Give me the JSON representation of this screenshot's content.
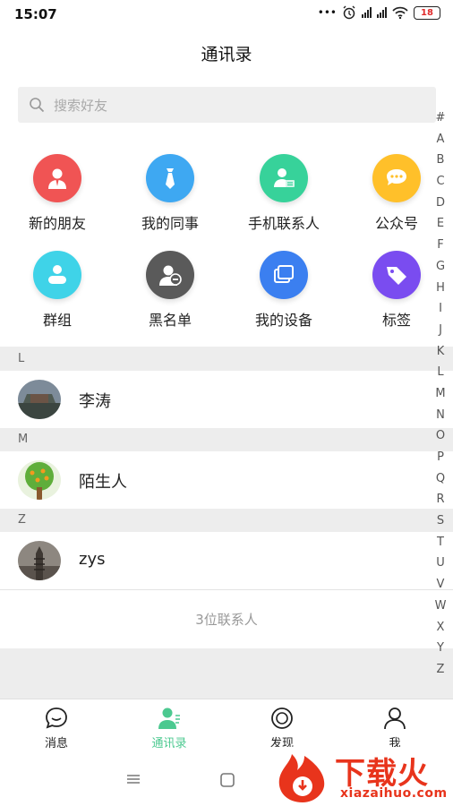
{
  "status_bar": {
    "time": "15:07",
    "battery": "18",
    "dots": "•••"
  },
  "header": {
    "title": "通讯录"
  },
  "search": {
    "placeholder": "搜索好友"
  },
  "quick_entries": [
    {
      "label": "新的朋友",
      "icon": "new-friend-icon",
      "color": "#f05454"
    },
    {
      "label": "我的同事",
      "icon": "tie-icon",
      "color": "#3ea8f2"
    },
    {
      "label": "手机联系人",
      "icon": "phone-contact-icon",
      "color": "#37d29a"
    },
    {
      "label": "公众号",
      "icon": "chat-bubble-icon",
      "color": "#ffc02a"
    },
    {
      "label": "群组",
      "icon": "group-icon",
      "color": "#3fd3e8"
    },
    {
      "label": "黑名单",
      "icon": "blocked-user-icon",
      "color": "#5a5a5a"
    },
    {
      "label": "我的设备",
      "icon": "device-icon",
      "color": "#3b7ff0"
    },
    {
      "label": "标签",
      "icon": "tag-icon",
      "color": "#7a4cf0"
    }
  ],
  "contacts": [
    {
      "section": "L",
      "name": "李涛"
    },
    {
      "section": "M",
      "name": "陌生人"
    },
    {
      "section": "Z",
      "name": "zys"
    }
  ],
  "contact_count": "3位联系人",
  "alphabet": [
    "#",
    "A",
    "B",
    "C",
    "D",
    "E",
    "F",
    "G",
    "H",
    "I",
    "J",
    "K",
    "L",
    "M",
    "N",
    "O",
    "P",
    "Q",
    "R",
    "S",
    "T",
    "U",
    "V",
    "W",
    "X",
    "Y",
    "Z"
  ],
  "tabs": [
    {
      "label": "消息",
      "icon": "message-icon",
      "active": false
    },
    {
      "label": "通讯录",
      "icon": "contacts-icon",
      "active": true
    },
    {
      "label": "发现",
      "icon": "discover-icon",
      "active": false
    },
    {
      "label": "我",
      "icon": "profile-icon",
      "active": false
    }
  ],
  "accent_color": "#4cc990",
  "watermark": {
    "text": "下载火",
    "sub": "xiazaihuo.com"
  }
}
